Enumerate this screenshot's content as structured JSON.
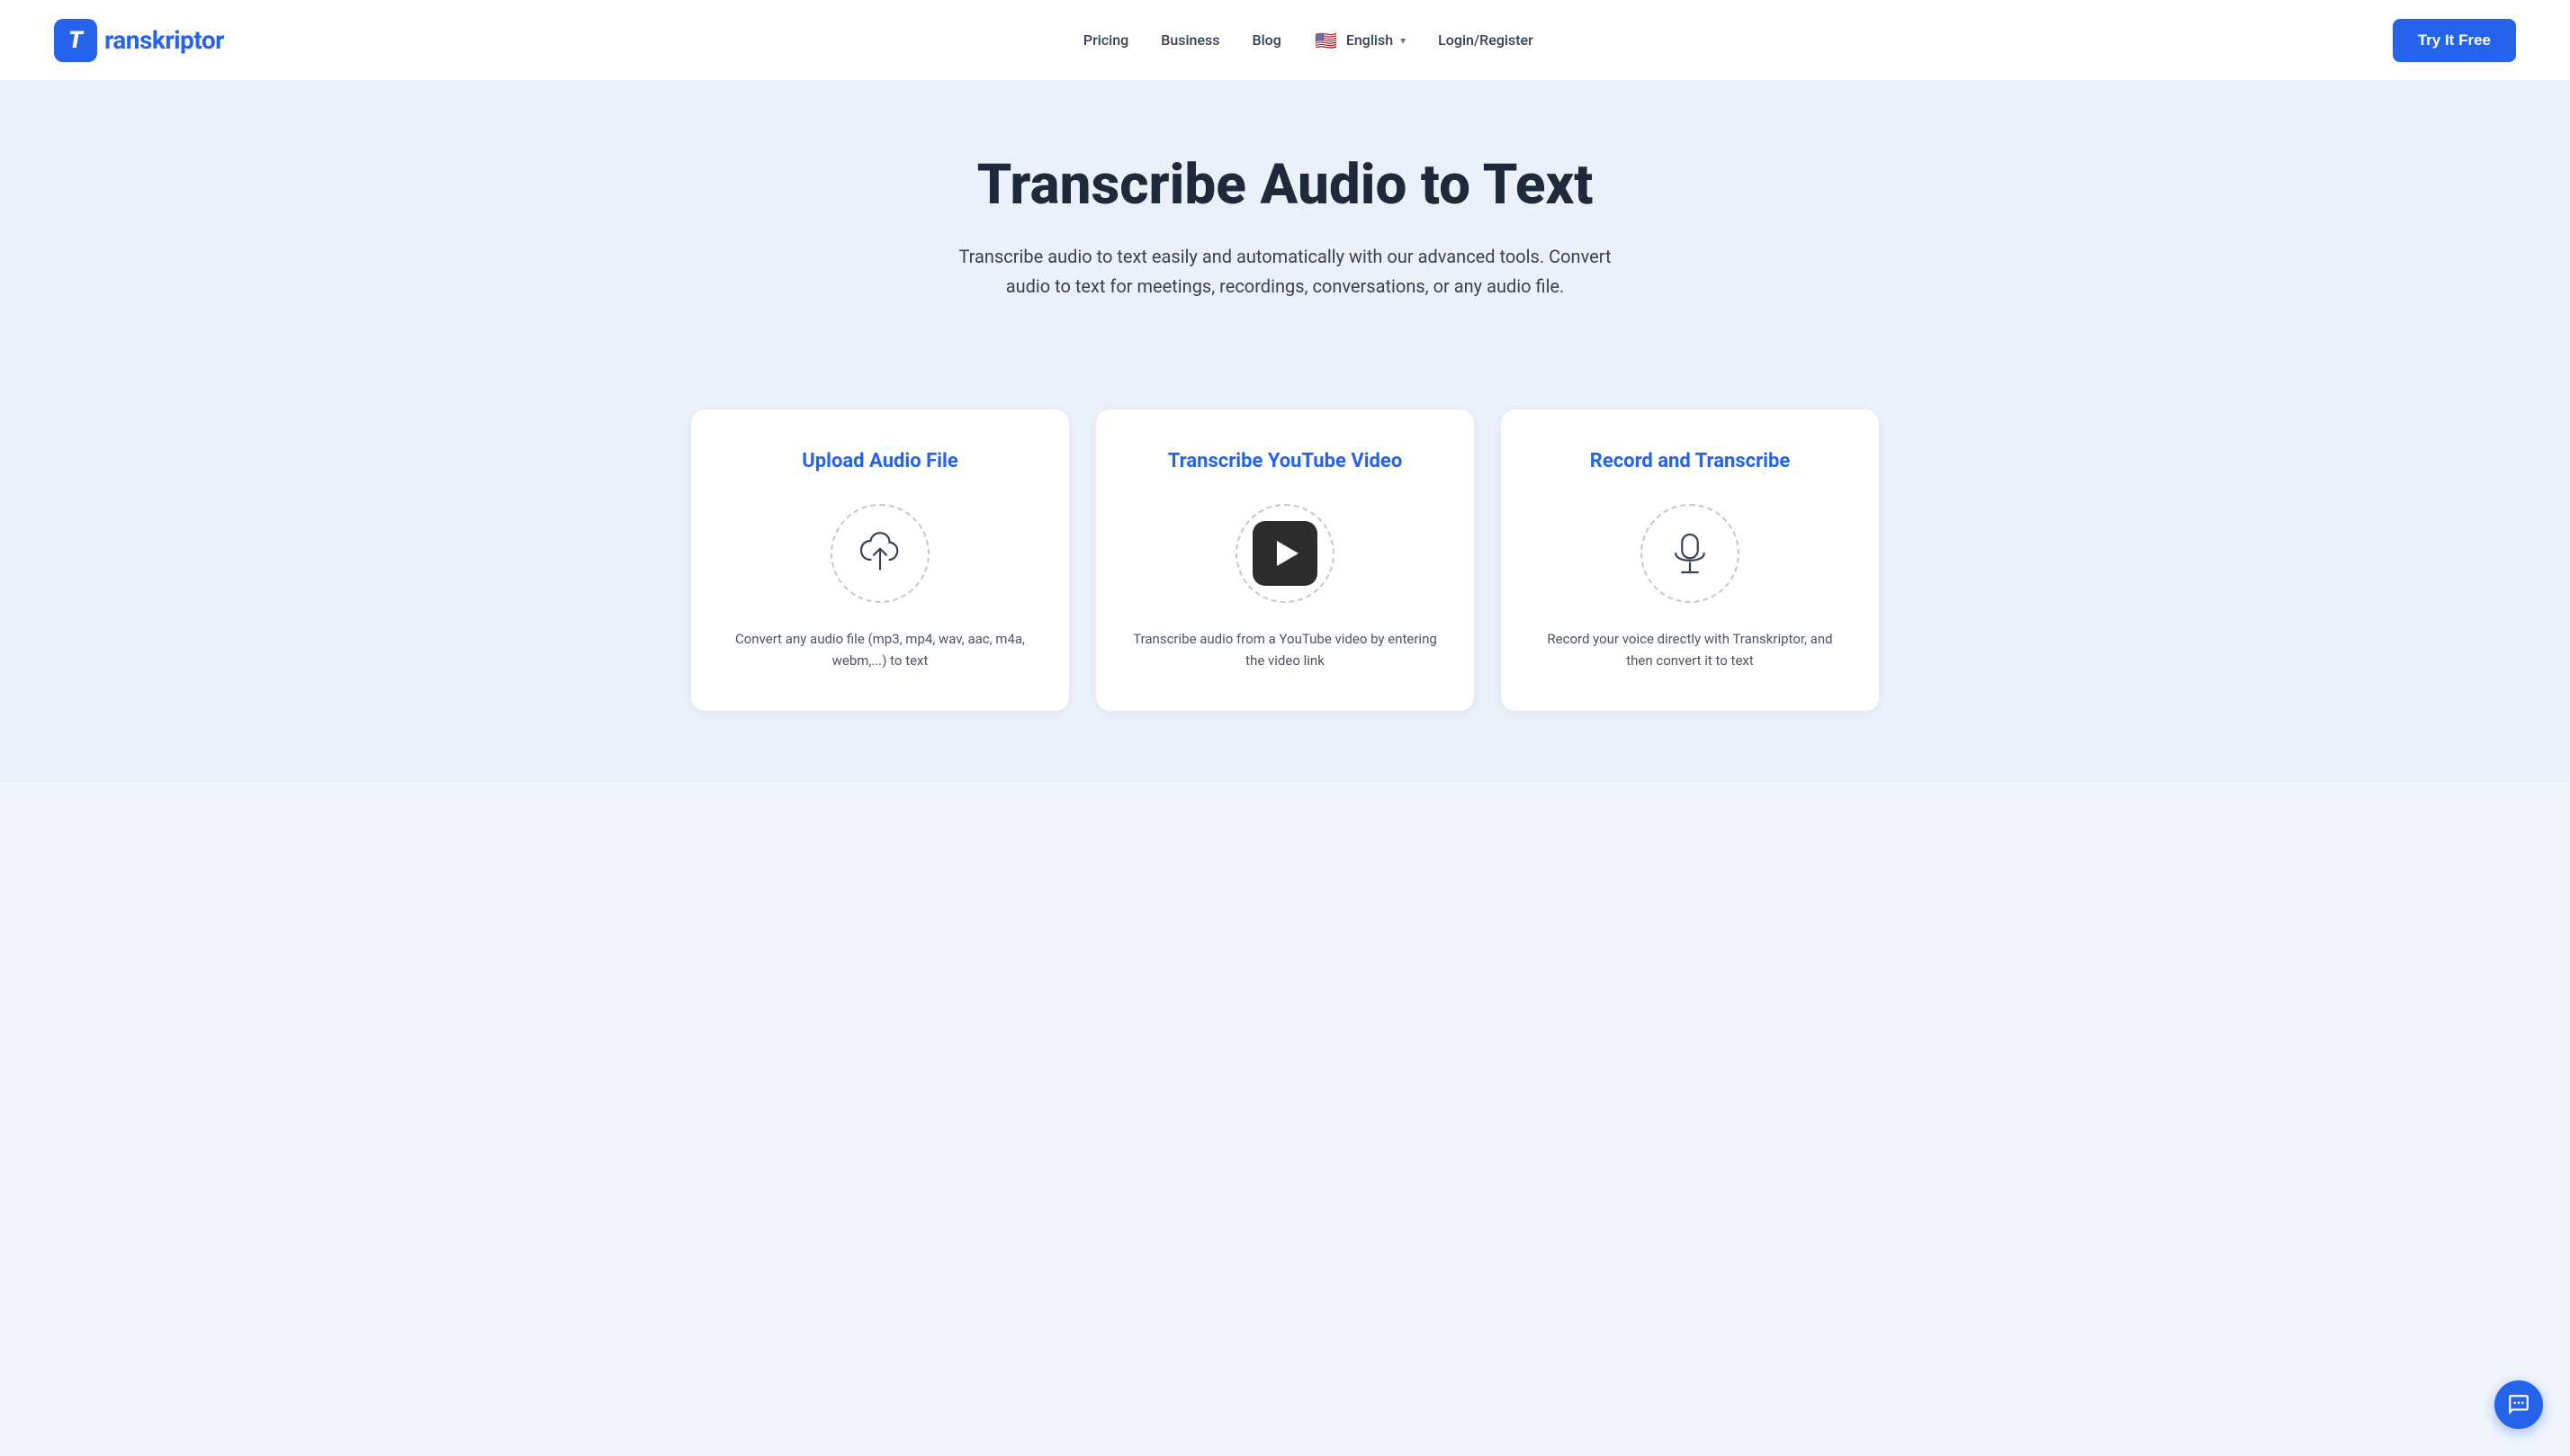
{
  "header": {
    "logo_letter": "T",
    "logo_name": "ranskriptor",
    "nav": {
      "pricing": "Pricing",
      "business": "Business",
      "blog": "Blog",
      "language": "English",
      "login": "Login/Register",
      "cta": "Try It Free"
    }
  },
  "hero": {
    "title": "Transcribe Audio to Text",
    "subtitle": "Transcribe audio to text easily and automatically with our advanced tools. Convert audio to text for meetings, recordings, conversations, or any audio file."
  },
  "cards": [
    {
      "id": "upload",
      "title": "Upload Audio File",
      "description": "Convert any audio file (mp3, mp4, wav, aac, m4a, webm,...) to text",
      "icon": "upload-cloud-icon"
    },
    {
      "id": "youtube",
      "title": "Transcribe YouTube Video",
      "description": "Transcribe audio from a YouTube video by entering the video link",
      "icon": "youtube-play-icon"
    },
    {
      "id": "record",
      "title": "Record and Transcribe",
      "description": "Record your voice directly with Transkriptor, and then convert it to text",
      "icon": "microphone-icon"
    }
  ],
  "chat": {
    "label": "Chat support"
  }
}
